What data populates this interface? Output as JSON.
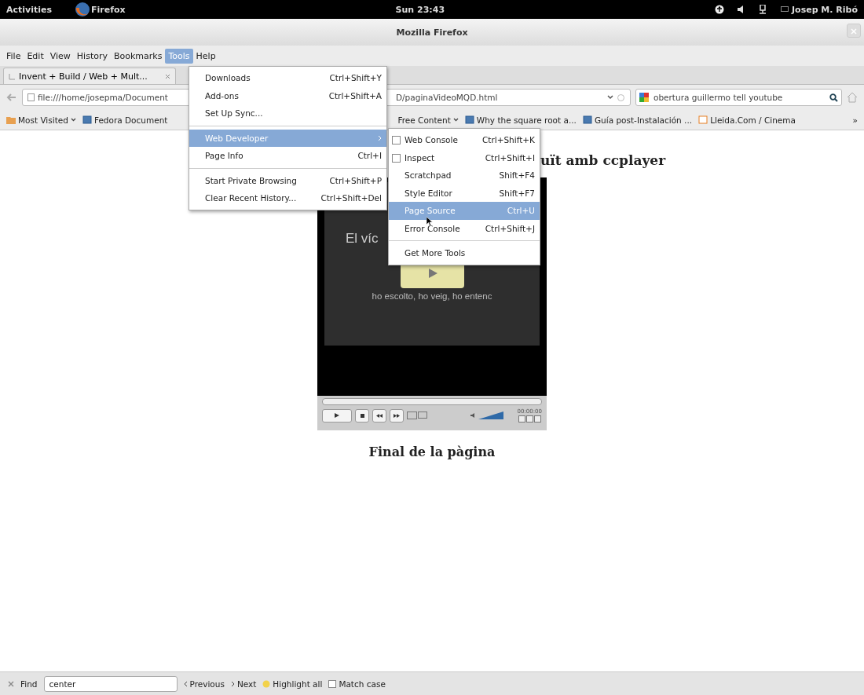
{
  "top_bar": {
    "activities": "Activities",
    "app": "Firefox",
    "clock": "Sun 23:43",
    "user": "Josep M. Ribó"
  },
  "window": {
    "title": "Mozilla Firefox"
  },
  "menu_bar": [
    {
      "label": "File",
      "selected": false
    },
    {
      "label": "Edit",
      "selected": false
    },
    {
      "label": "View",
      "selected": false
    },
    {
      "label": "History",
      "selected": false
    },
    {
      "label": "Bookmarks",
      "selected": false
    },
    {
      "label": "Tools",
      "selected": true
    },
    {
      "label": "Help",
      "selected": false
    }
  ],
  "tabs": [
    {
      "label": "Invent + Build / Web + Mult...",
      "selected": true
    }
  ],
  "address": {
    "visible_start": "file:///home/josepma/Document",
    "visible_end": "D/paginaVideoMQD.html"
  },
  "search": {
    "value": "obertura guillermo tell youtube"
  },
  "bookmarks": [
    {
      "label": "Most Visited",
      "kind": "folder"
    },
    {
      "label": "Fedora Document",
      "kind": "page"
    },
    {
      "label": "Free Content",
      "kind": "folder"
    },
    {
      "label": "Why the square root a...",
      "kind": "page"
    },
    {
      "label": "Guía post-Instalación ...",
      "kind": "page"
    },
    {
      "label": "Lleida.Com / Cinema",
      "kind": "page"
    }
  ],
  "bookmarks_more": "»",
  "page": {
    "heading_visible": "uït amb ccplayer",
    "video_text": "El víc",
    "caption": "ho escolto, ho veig, ho entenc",
    "time": "00:00:00",
    "volume": {
      "level": 0.7
    },
    "footer": "Final de la pàgina"
  },
  "tools_menu": [
    {
      "kind": "item",
      "label": "Downloads",
      "shortcut": "Ctrl+Shift+Y",
      "selected": false
    },
    {
      "kind": "item",
      "label": "Add-ons",
      "shortcut": "Ctrl+Shift+A",
      "selected": false
    },
    {
      "kind": "item",
      "label": "Set Up Sync...",
      "selected": false
    },
    {
      "kind": "separator"
    },
    {
      "kind": "submenu",
      "label": "Web Developer",
      "selected": true
    },
    {
      "kind": "item",
      "label": "Page Info",
      "shortcut": "Ctrl+I",
      "selected": false
    },
    {
      "kind": "separator"
    },
    {
      "kind": "item",
      "label": "Start Private Browsing",
      "shortcut": "Ctrl+Shift+P",
      "selected": false
    },
    {
      "kind": "item",
      "label": "Clear Recent History...",
      "shortcut": "Ctrl+Shift+Del",
      "selected": false
    }
  ],
  "web_developer_menu": [
    {
      "kind": "checkbox",
      "label": "Web Console",
      "shortcut": "Ctrl+Shift+K",
      "checked": false,
      "selected": false
    },
    {
      "kind": "checkbox",
      "label": "Inspect",
      "shortcut": "Ctrl+Shift+I",
      "checked": false,
      "selected": false
    },
    {
      "kind": "item",
      "label": "Scratchpad",
      "shortcut": "Shift+F4",
      "selected": false
    },
    {
      "kind": "item",
      "label": "Style Editor",
      "shortcut": "Shift+F7",
      "selected": false
    },
    {
      "kind": "item",
      "label": "Page Source",
      "shortcut": "Ctrl+U",
      "selected": true
    },
    {
      "kind": "item",
      "label": "Error Console",
      "shortcut": "Ctrl+Shift+J",
      "selected": false
    },
    {
      "kind": "separator"
    },
    {
      "kind": "item",
      "label": "Get More Tools",
      "selected": false
    }
  ],
  "find_bar": {
    "label": "Find",
    "value": "center",
    "previous": "Previous",
    "next": "Next",
    "highlight": "Highlight all",
    "match_case": {
      "label": "Match case",
      "checked": false
    }
  }
}
